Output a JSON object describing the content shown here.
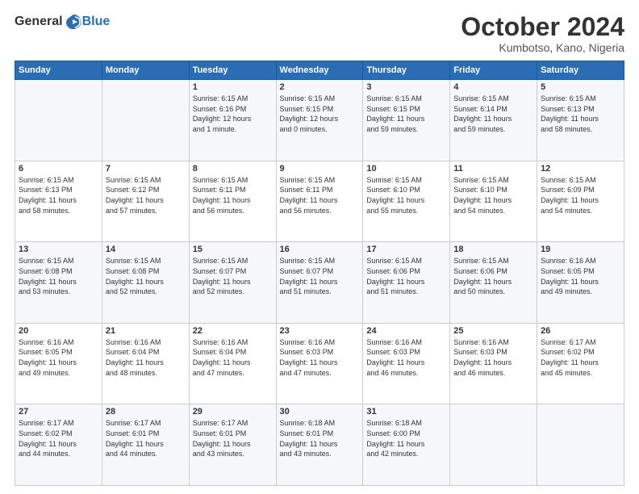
{
  "logo": {
    "general": "General",
    "blue": "Blue"
  },
  "header": {
    "month": "October 2024",
    "location": "Kumbotso, Kano, Nigeria"
  },
  "days_of_week": [
    "Sunday",
    "Monday",
    "Tuesday",
    "Wednesday",
    "Thursday",
    "Friday",
    "Saturday"
  ],
  "weeks": [
    [
      {
        "day": "",
        "info": ""
      },
      {
        "day": "",
        "info": ""
      },
      {
        "day": "1",
        "info": "Sunrise: 6:15 AM\nSunset: 6:16 PM\nDaylight: 12 hours\nand 1 minute."
      },
      {
        "day": "2",
        "info": "Sunrise: 6:15 AM\nSunset: 6:15 PM\nDaylight: 12 hours\nand 0 minutes."
      },
      {
        "day": "3",
        "info": "Sunrise: 6:15 AM\nSunset: 6:15 PM\nDaylight: 11 hours\nand 59 minutes."
      },
      {
        "day": "4",
        "info": "Sunrise: 6:15 AM\nSunset: 6:14 PM\nDaylight: 11 hours\nand 59 minutes."
      },
      {
        "day": "5",
        "info": "Sunrise: 6:15 AM\nSunset: 6:13 PM\nDaylight: 11 hours\nand 58 minutes."
      }
    ],
    [
      {
        "day": "6",
        "info": "Sunrise: 6:15 AM\nSunset: 6:13 PM\nDaylight: 11 hours\nand 58 minutes."
      },
      {
        "day": "7",
        "info": "Sunrise: 6:15 AM\nSunset: 6:12 PM\nDaylight: 11 hours\nand 57 minutes."
      },
      {
        "day": "8",
        "info": "Sunrise: 6:15 AM\nSunset: 6:11 PM\nDaylight: 11 hours\nand 56 minutes."
      },
      {
        "day": "9",
        "info": "Sunrise: 6:15 AM\nSunset: 6:11 PM\nDaylight: 11 hours\nand 56 minutes."
      },
      {
        "day": "10",
        "info": "Sunrise: 6:15 AM\nSunset: 6:10 PM\nDaylight: 11 hours\nand 55 minutes."
      },
      {
        "day": "11",
        "info": "Sunrise: 6:15 AM\nSunset: 6:10 PM\nDaylight: 11 hours\nand 54 minutes."
      },
      {
        "day": "12",
        "info": "Sunrise: 6:15 AM\nSunset: 6:09 PM\nDaylight: 11 hours\nand 54 minutes."
      }
    ],
    [
      {
        "day": "13",
        "info": "Sunrise: 6:15 AM\nSunset: 6:08 PM\nDaylight: 11 hours\nand 53 minutes."
      },
      {
        "day": "14",
        "info": "Sunrise: 6:15 AM\nSunset: 6:08 PM\nDaylight: 11 hours\nand 52 minutes."
      },
      {
        "day": "15",
        "info": "Sunrise: 6:15 AM\nSunset: 6:07 PM\nDaylight: 11 hours\nand 52 minutes."
      },
      {
        "day": "16",
        "info": "Sunrise: 6:15 AM\nSunset: 6:07 PM\nDaylight: 11 hours\nand 51 minutes."
      },
      {
        "day": "17",
        "info": "Sunrise: 6:15 AM\nSunset: 6:06 PM\nDaylight: 11 hours\nand 51 minutes."
      },
      {
        "day": "18",
        "info": "Sunrise: 6:15 AM\nSunset: 6:06 PM\nDaylight: 11 hours\nand 50 minutes."
      },
      {
        "day": "19",
        "info": "Sunrise: 6:16 AM\nSunset: 6:05 PM\nDaylight: 11 hours\nand 49 minutes."
      }
    ],
    [
      {
        "day": "20",
        "info": "Sunrise: 6:16 AM\nSunset: 6:05 PM\nDaylight: 11 hours\nand 49 minutes."
      },
      {
        "day": "21",
        "info": "Sunrise: 6:16 AM\nSunset: 6:04 PM\nDaylight: 11 hours\nand 48 minutes."
      },
      {
        "day": "22",
        "info": "Sunrise: 6:16 AM\nSunset: 6:04 PM\nDaylight: 11 hours\nand 47 minutes."
      },
      {
        "day": "23",
        "info": "Sunrise: 6:16 AM\nSunset: 6:03 PM\nDaylight: 11 hours\nand 47 minutes."
      },
      {
        "day": "24",
        "info": "Sunrise: 6:16 AM\nSunset: 6:03 PM\nDaylight: 11 hours\nand 46 minutes."
      },
      {
        "day": "25",
        "info": "Sunrise: 6:16 AM\nSunset: 6:03 PM\nDaylight: 11 hours\nand 46 minutes."
      },
      {
        "day": "26",
        "info": "Sunrise: 6:17 AM\nSunset: 6:02 PM\nDaylight: 11 hours\nand 45 minutes."
      }
    ],
    [
      {
        "day": "27",
        "info": "Sunrise: 6:17 AM\nSunset: 6:02 PM\nDaylight: 11 hours\nand 44 minutes."
      },
      {
        "day": "28",
        "info": "Sunrise: 6:17 AM\nSunset: 6:01 PM\nDaylight: 11 hours\nand 44 minutes."
      },
      {
        "day": "29",
        "info": "Sunrise: 6:17 AM\nSunset: 6:01 PM\nDaylight: 11 hours\nand 43 minutes."
      },
      {
        "day": "30",
        "info": "Sunrise: 6:18 AM\nSunset: 6:01 PM\nDaylight: 11 hours\nand 43 minutes."
      },
      {
        "day": "31",
        "info": "Sunrise: 6:18 AM\nSunset: 6:00 PM\nDaylight: 11 hours\nand 42 minutes."
      },
      {
        "day": "",
        "info": ""
      },
      {
        "day": "",
        "info": ""
      }
    ]
  ]
}
